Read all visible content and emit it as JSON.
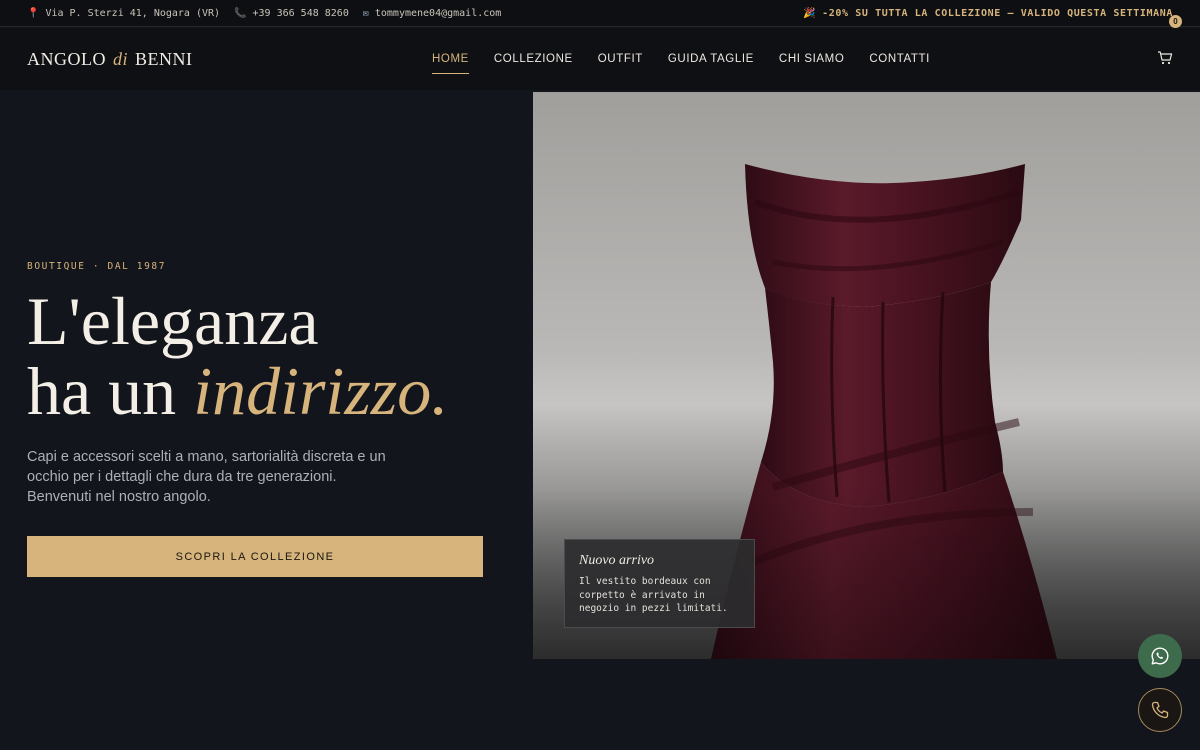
{
  "topbar": {
    "address": "Via P. Sterzi 41, Nogara (VR)",
    "phone": "+39 366 548 8260",
    "email": "tommymene04@gmail.com",
    "promo": "-20% SU TUTTA LA COLLEZIONE — VALIDO QUESTA SETTIMANA",
    "icons": [
      "pin-icon",
      "phone-icon",
      "mail-icon",
      "party-icon"
    ]
  },
  "header": {
    "logo_part1": "ANGOLO",
    "logo_part2": "di",
    "logo_part3": "BENNI",
    "nav": [
      "HOME",
      "COLLEZIONE",
      "OUTFIT",
      "GUIDA TAGLIE",
      "CHI SIAMO",
      "CONTATTI"
    ],
    "active_nav": "HOME",
    "cart_count": "0"
  },
  "hero": {
    "eyebrow": "BOUTIQUE · DAL 1987",
    "headline_line1": "L'eleganza",
    "headline_line2_plain": "ha un ",
    "headline_line2_accent": "indirizzo.",
    "lead": "Capi e accessori scelti a mano, sartorialità discreta e un occhio per i dettagli che dura da tre generazioni. Benvenuti nel nostro angolo.",
    "cta": "SCOPRI LA COLLEZIONE"
  },
  "note": {
    "title": "Nuovo arrivo",
    "body": "Il vestito bordeaux con corpetto è arrivato in negozio in pezzi limitati."
  },
  "colors": {
    "accent": "#d6b47c",
    "background": "#12151c",
    "whatsapp": "#3e6b4c",
    "dress": "#4a1322"
  }
}
